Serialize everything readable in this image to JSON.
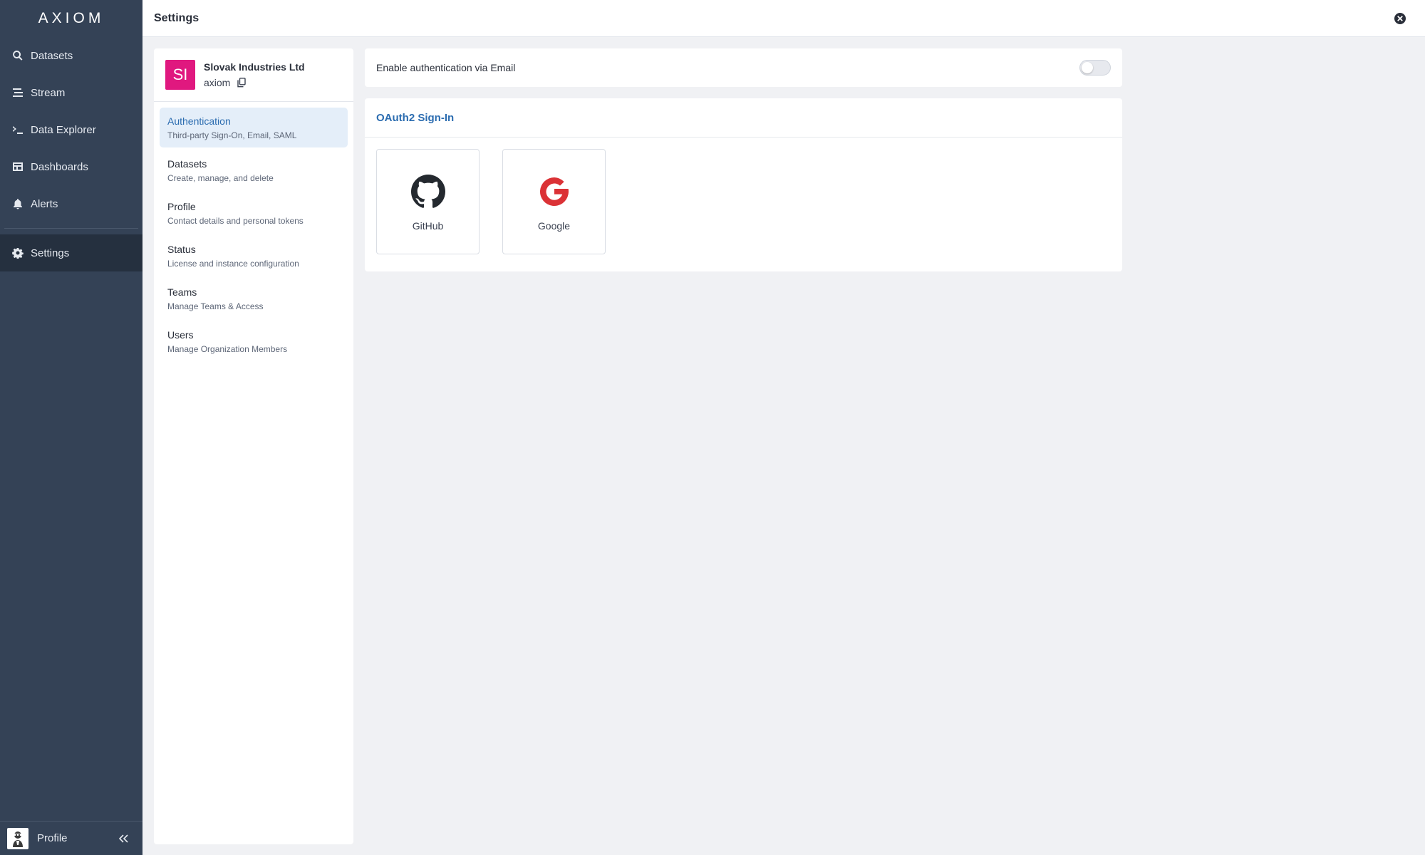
{
  "app": {
    "logo": "AXIOM"
  },
  "sidebar": {
    "items": [
      {
        "label": "Datasets",
        "icon": "search-icon"
      },
      {
        "label": "Stream",
        "icon": "stream-icon"
      },
      {
        "label": "Data Explorer",
        "icon": "terminal-icon"
      },
      {
        "label": "Dashboards",
        "icon": "dashboard-icon"
      },
      {
        "label": "Alerts",
        "icon": "bell-icon"
      }
    ],
    "settings": {
      "label": "Settings",
      "icon": "gear-icon"
    },
    "profile": {
      "label": "Profile",
      "icon": "avatar",
      "collapse_icon": "double-chevron-left-icon"
    }
  },
  "header": {
    "title": "Settings",
    "close_icon": "close-circle-icon"
  },
  "org": {
    "initials": "SI",
    "name": "Slovak Industries Ltd",
    "slug": "axiom",
    "avatar_color": "#e0187f"
  },
  "settings_menu": [
    {
      "title": "Authentication",
      "subtitle": "Third-party Sign-On, Email, SAML",
      "active": true
    },
    {
      "title": "Datasets",
      "subtitle": "Create, manage, and delete"
    },
    {
      "title": "Profile",
      "subtitle": "Contact details and personal tokens"
    },
    {
      "title": "Status",
      "subtitle": "License and instance configuration"
    },
    {
      "title": "Teams",
      "subtitle": "Manage Teams & Access"
    },
    {
      "title": "Users",
      "subtitle": "Manage Organization Members"
    }
  ],
  "email_auth": {
    "label": "Enable authentication via Email",
    "enabled": false
  },
  "oauth": {
    "title": "OAuth2 Sign-In",
    "providers": [
      {
        "label": "GitHub",
        "icon": "github-icon"
      },
      {
        "label": "Google",
        "icon": "google-icon",
        "color": "#db3236"
      }
    ]
  },
  "colors": {
    "sidebar_bg": "#344256",
    "accent": "#2b6cb0"
  }
}
